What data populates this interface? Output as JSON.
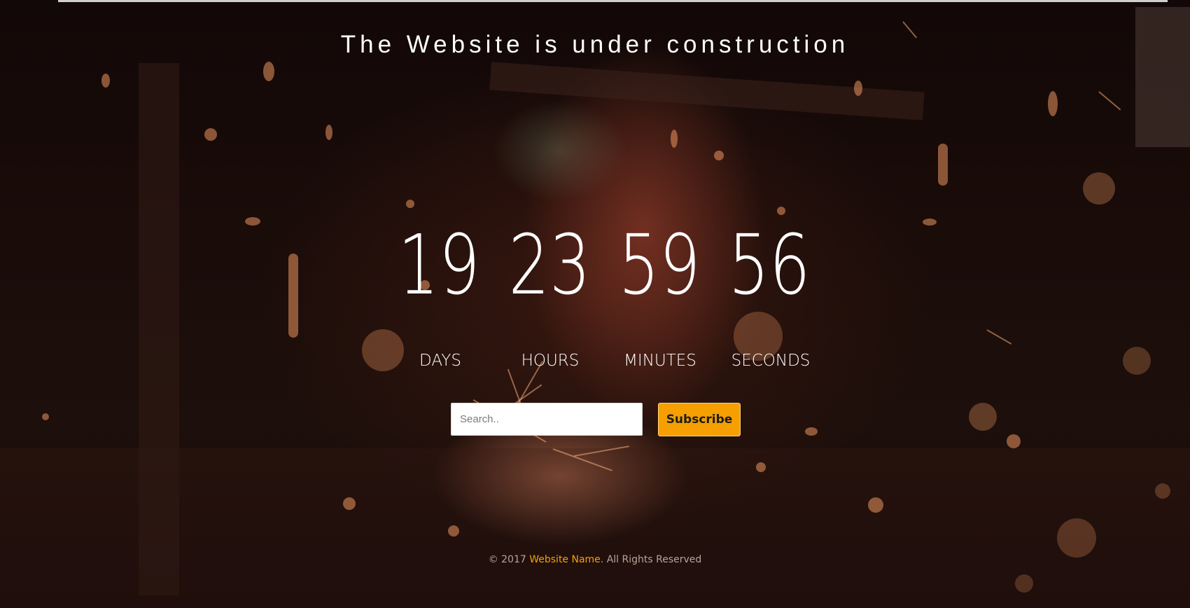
{
  "header": {
    "title": "The Website is under construction"
  },
  "countdown": {
    "days": "19",
    "hours": "23",
    "minutes": "59",
    "seconds": "56",
    "labels": {
      "days": "DAYS",
      "hours": "HOURS",
      "minutes": "MINUTES",
      "seconds": "SECONDS"
    }
  },
  "subscribe": {
    "placeholder": "Search..",
    "button_label": "Subscribe"
  },
  "footer": {
    "prefix": "© 2017 ",
    "brand": "Website Name",
    "suffix": ". All Rights Reserved"
  },
  "colors": {
    "accent": "#f5a000",
    "text": "#ffffff",
    "background": "#1a0c09"
  }
}
